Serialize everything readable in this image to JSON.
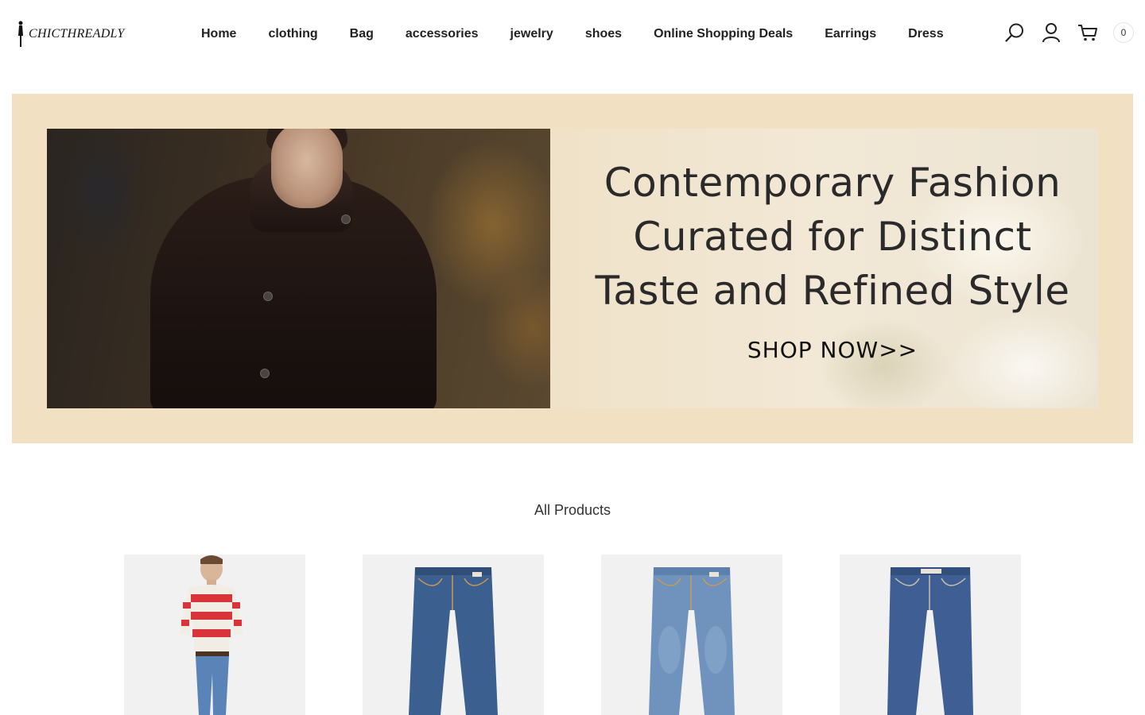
{
  "header": {
    "logo_text": "CHICTHREADLY",
    "nav": [
      "Home",
      "clothing",
      "Bag",
      "accessories",
      "jewelry",
      "shoes",
      "Online Shopping Deals",
      "Earrings",
      "Dress"
    ],
    "cart_count": "0"
  },
  "icons": {
    "search": "search-icon",
    "account": "user-icon",
    "cart": "cart-icon"
  },
  "banner": {
    "headline_line1": "Contemporary Fashion",
    "headline_line2": "Curated for Distinct",
    "headline_line3": "Taste and Refined Style",
    "cta": "SHOP NOW>>",
    "background_color": "#f1e0c2"
  },
  "products": {
    "title": "All Products",
    "items": [
      {
        "image": "red-striped-sweater-model"
      },
      {
        "image": "dark-wash-jeans"
      },
      {
        "image": "light-wash-jeans"
      },
      {
        "image": "medium-wash-jeans"
      }
    ]
  }
}
